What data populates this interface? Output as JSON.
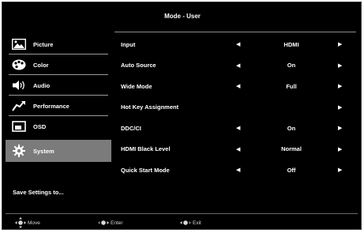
{
  "header": {
    "title": "Mode - User"
  },
  "sidebar": {
    "items": [
      {
        "label": "Picture",
        "icon": "picture-icon"
      },
      {
        "label": "Color",
        "icon": "palette-icon"
      },
      {
        "label": "Audio",
        "icon": "speaker-icon"
      },
      {
        "label": "Performance",
        "icon": "performance-icon"
      },
      {
        "label": "OSD",
        "icon": "osd-icon"
      },
      {
        "label": "System",
        "icon": "gear-icon",
        "selected": true
      }
    ],
    "save_label": "Save Settings to..."
  },
  "settings": [
    {
      "label": "Input",
      "value": "HDMI"
    },
    {
      "label": "Auto Source",
      "value": "On"
    },
    {
      "label": "Wide Mode",
      "value": "Full"
    },
    {
      "label": "Hot Key Assignment",
      "value": ""
    },
    {
      "label": "DDC/CI",
      "value": "On"
    },
    {
      "label": "HDMI Black Level",
      "value": "Normal"
    },
    {
      "label": "Quick Start Mode",
      "value": "Off"
    }
  ],
  "footer": {
    "move": "Move",
    "enter": "Enter",
    "exit": "Exit"
  },
  "colors": {
    "background": "#000000",
    "selected": "#7b7b7b",
    "text": "#ffffff"
  }
}
